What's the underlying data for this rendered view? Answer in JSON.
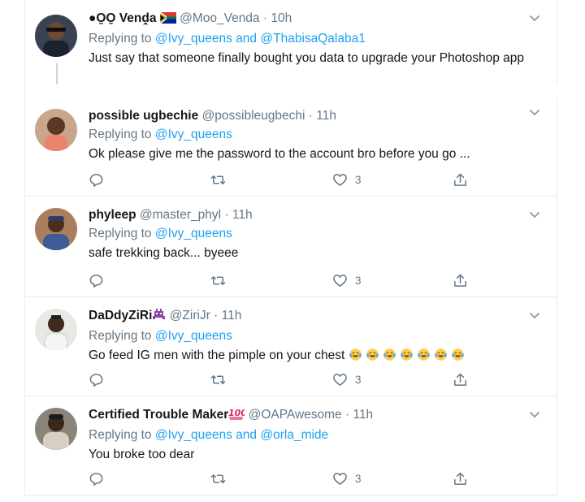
{
  "tweets": [
    {
      "name": "●O̱O̱ Venḓa",
      "flag_emoji": "south-africa-flag",
      "handle": "@Moo_Venda",
      "time": "10h",
      "replying_prefix": "Replying to",
      "mention1": "@Ivy_queens",
      "mention_sep": "and",
      "mention2": "@ThabisaQalaba1",
      "text": "Just say that someone finally bought you data to upgrade your Photoshop app",
      "likes": ""
    },
    {
      "name": "possible ugbechie",
      "handle": "@possibleugbechi",
      "time": "11h",
      "replying_prefix": "Replying to",
      "mention1": "@Ivy_queens",
      "text": "Ok please give me the password to the account bro before you go ...",
      "likes": "3"
    },
    {
      "name": "phyleep",
      "handle": "@master_phyl",
      "time": "11h",
      "replying_prefix": "Replying to",
      "mention1": "@Ivy_queens",
      "text": "safe trekking back... byeee",
      "likes": "3"
    },
    {
      "name": "DaDdyZiRi",
      "name_badge": "alien-monster-emoji",
      "handle": "@ZiriJr",
      "time": "11h",
      "replying_prefix": "Replying to",
      "mention1": "@Ivy_queens",
      "text": "Go feed IG men with the pimple on your chest",
      "text_emoji": "face-with-tears-of-joy",
      "text_emoji_count": 7,
      "likes": "3"
    },
    {
      "name": "Certified Trouble Maker",
      "name_badge": "hundred-points-emoji",
      "handle": "@OAPAwesome",
      "time": "11h",
      "replying_prefix": "Replying to",
      "mention1": "@Ivy_queens",
      "mention_sep": "and",
      "mention2": "@orla_mide",
      "text": "You broke too dear",
      "likes": "3"
    }
  ],
  "separator": "·",
  "colors": {
    "link": "#1da1f2",
    "secondary": "#657786",
    "text": "#14171a",
    "divider": "#e6ecf0"
  }
}
